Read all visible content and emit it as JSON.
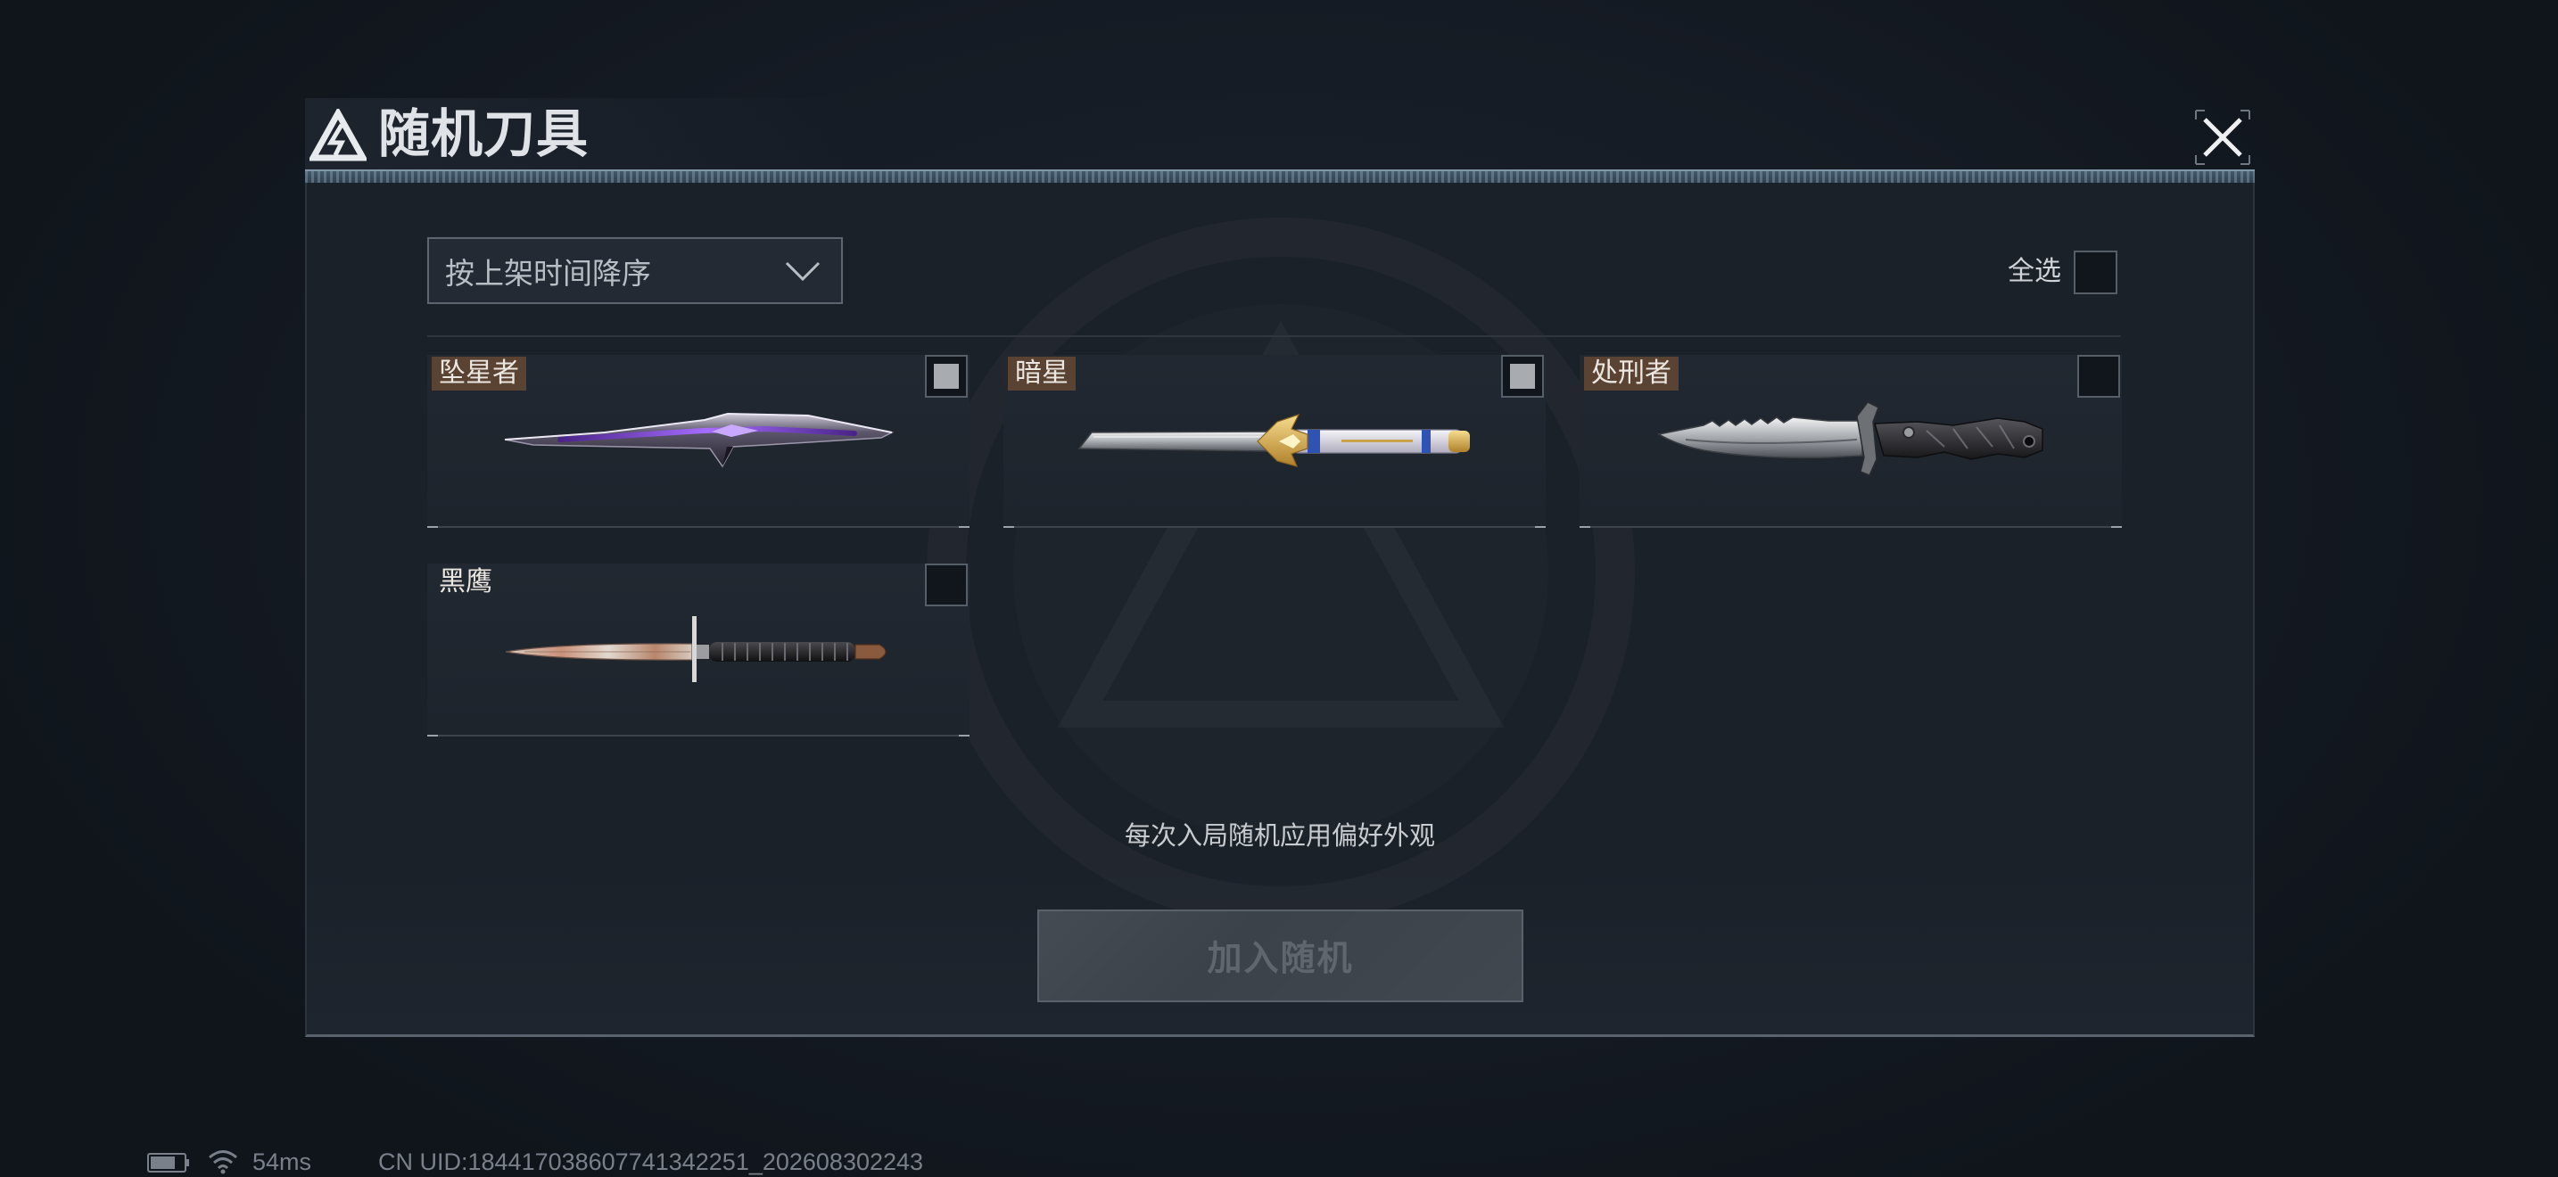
{
  "window": {
    "title": "随机刀具",
    "title_icon": "triangle-logo-icon",
    "close_icon": "close-icon"
  },
  "toolbar": {
    "sort_select": {
      "selected": "按上架时间降序",
      "icon": "chevron-down-icon"
    },
    "select_all": {
      "label": "全选",
      "checked": false
    }
  },
  "knives": [
    {
      "name": "坠星者",
      "tag_color": "#5b4334",
      "checked": true,
      "image": "purple-star-dagger"
    },
    {
      "name": "暗星",
      "tag_color": "#5b4334",
      "checked": true,
      "image": "silver-gold-winged-blade"
    },
    {
      "name": "处刑者",
      "tag_color": "#5b4334",
      "checked": false,
      "image": "serrated-combat-knife"
    },
    {
      "name": "黑鹰",
      "tag_color": "transparent",
      "checked": false,
      "image": "black-handle-dagger"
    }
  ],
  "hint": "每次入局随机应用偏好外观",
  "action_button": {
    "label": "加入随机",
    "enabled": false
  },
  "status_bar": {
    "battery_icon": "battery-icon",
    "battery_level": 0.75,
    "wifi_icon": "wifi-icon",
    "ping": "54ms",
    "uid": "CN UID:184417038607741342251_202608302243"
  },
  "colors": {
    "background": "#141a23",
    "panel": "#1b2129",
    "checkbox_mark": "#a8acb1",
    "button_disabled": "#3b424a"
  }
}
